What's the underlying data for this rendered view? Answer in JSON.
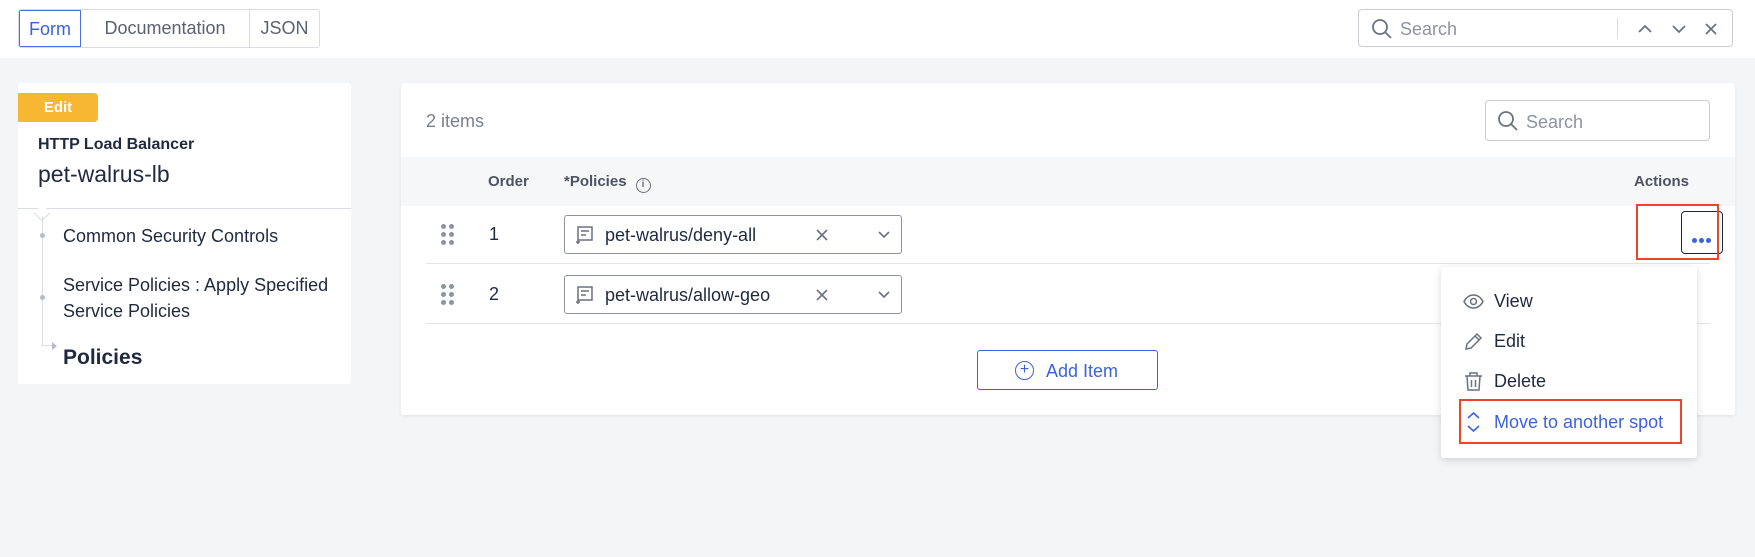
{
  "tabs": [
    {
      "label": "Form",
      "active": true
    },
    {
      "label": "Documentation",
      "active": false
    },
    {
      "label": "JSON",
      "active": false
    }
  ],
  "top_search": {
    "placeholder": "Search"
  },
  "sidebar": {
    "badge": "Edit",
    "object_type": "HTTP Load Balancer",
    "object_name": "pet-walrus-lb",
    "tree": [
      {
        "label": "Common Security Controls"
      },
      {
        "label": "Service Policies : Apply Specified Service Policies"
      },
      {
        "label": "Policies",
        "current": true
      }
    ]
  },
  "table": {
    "count_label": "2 items",
    "search_placeholder": "Search",
    "columns": {
      "order": "Order",
      "policies": "*Policies",
      "actions": "Actions"
    },
    "rows": [
      {
        "order": "1",
        "policy": "pet-walrus/deny-all"
      },
      {
        "order": "2",
        "policy": "pet-walrus/allow-geo"
      }
    ],
    "add_label": "Add Item"
  },
  "action_menu": {
    "items": [
      {
        "label": "View",
        "icon": "eye-icon"
      },
      {
        "label": "Edit",
        "icon": "pencil-icon"
      },
      {
        "label": "Delete",
        "icon": "trash-icon"
      },
      {
        "label": "Move to another spot",
        "icon": "move-updown-icon",
        "highlighted": true
      }
    ]
  },
  "colors": {
    "accent": "#3c63d8",
    "badge": "#f7b733",
    "highlight": "#e9462b"
  }
}
